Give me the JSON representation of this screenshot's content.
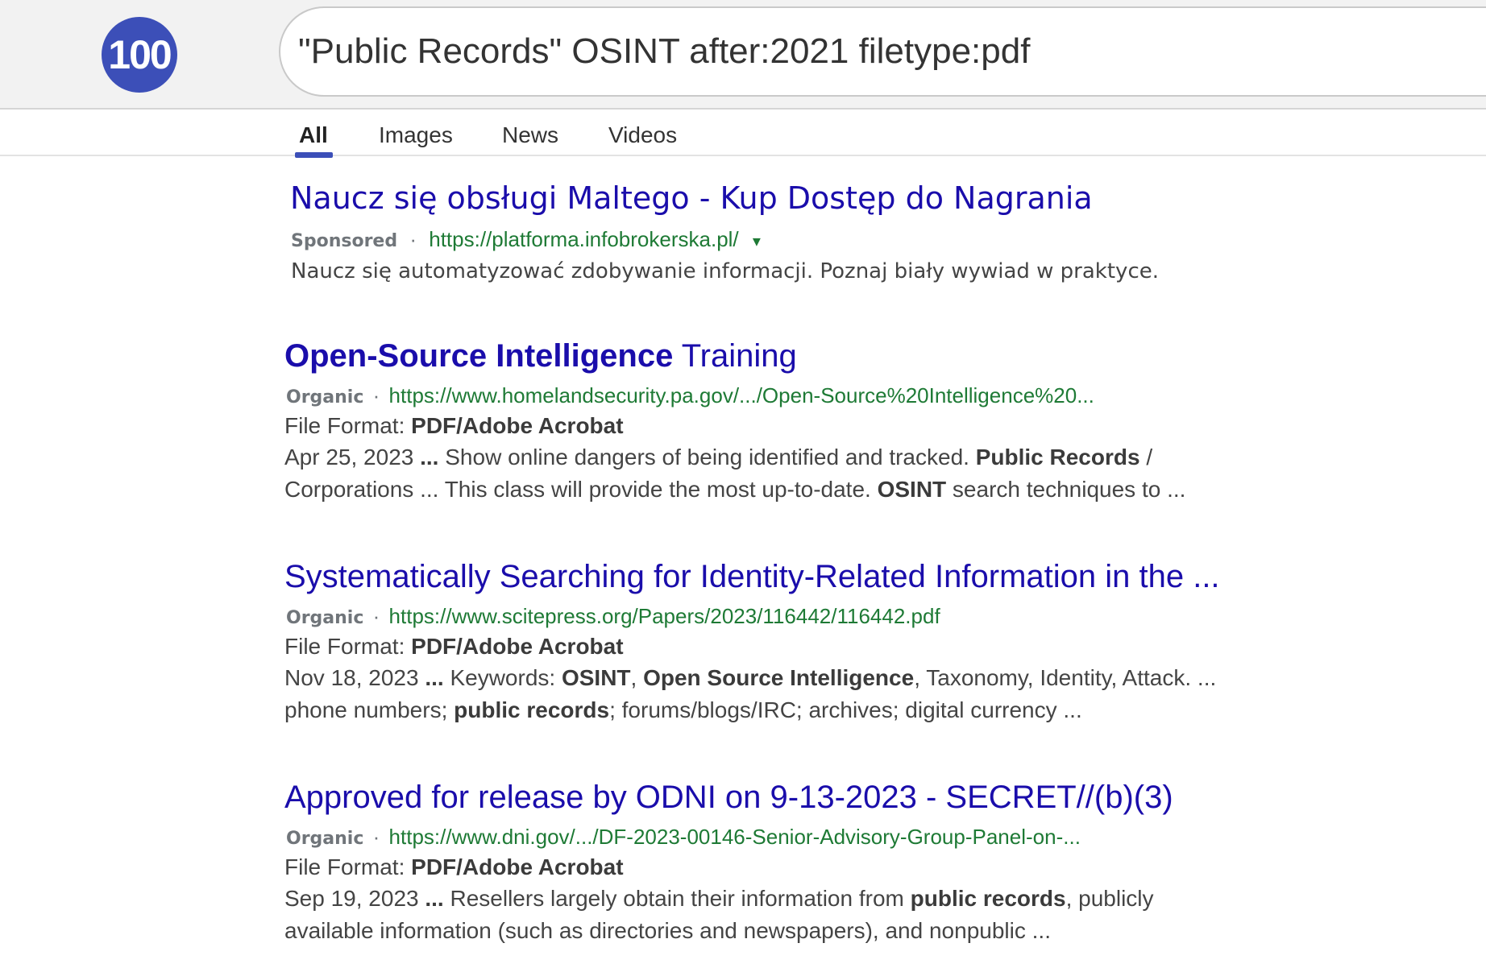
{
  "logo": {
    "text": "100",
    "color": "#3c4fb8"
  },
  "search": {
    "query": "\"Public Records\" OSINT after:2021 filetype:pdf"
  },
  "tabs": [
    {
      "label": "All",
      "active": true
    },
    {
      "label": "Images"
    },
    {
      "label": "News"
    },
    {
      "label": "Videos"
    }
  ],
  "sponsored": {
    "title": "Naucz się obsługi Maltego - Kup Dostęp do Nagrania",
    "tag": "Sponsored",
    "separator": "·",
    "url": "https://platforma.infobrokerska.pl/",
    "caret": "▾",
    "description": "Naucz się automatyzować zdobywanie informacji. Poznaj biały wywiad w praktyce."
  },
  "results": [
    {
      "title_bold": "Open-Source Intelligence",
      "title_rest": " Training",
      "tag": "Organic",
      "separator": "·",
      "url": "https://www.homelandsecurity.pa.gov/.../Open-Source%20Intelligence%20...",
      "format_label": "File Format:",
      "format_value": "PDF/Adobe Acrobat",
      "snippet1": {
        "a": "Apr 25, 2023 ",
        "b": "...",
        "c": " Show online dangers of being identified and tracked. ",
        "d": "Public Records",
        "e": " /"
      },
      "snippet2": {
        "a": "Corporations ... This class will provide the most up-to-date. ",
        "b": "OSINT",
        "c": " search techniques to ..."
      }
    },
    {
      "title": "Systematically Searching for Identity-Related Information in the ...",
      "tag": "Organic",
      "separator": "·",
      "url": "https://www.scitepress.org/Papers/2023/116442/116442.pdf",
      "format_label": "File Format:",
      "format_value": "PDF/Adobe Acrobat",
      "snippet1": {
        "a": "Nov 18, 2023 ",
        "b": "...",
        "c": " Keywords: ",
        "d": "OSINT",
        "e": ", ",
        "f": "Open Source Intelligence",
        "g": ", Taxonomy, Identity, Attack. ..."
      },
      "snippet2": {
        "a": "phone numbers; ",
        "b": "public records",
        "c": "; forums/blogs/IRC; archives; digital currency ..."
      }
    },
    {
      "title": "Approved for release by ODNI on 9-13-2023 - SECRET//(b)(3)",
      "tag": "Organic",
      "separator": "·",
      "url": "https://www.dni.gov/.../DF-2023-00146-Senior-Advisory-Group-Panel-on-...",
      "format_label": "File Format:",
      "format_value": "PDF/Adobe Acrobat",
      "snippet1": {
        "a": "Sep 19, 2023 ",
        "b": "...",
        "c": " Resellers largely obtain their information from ",
        "d": "public records",
        "e": ", publicly"
      },
      "snippet2": {
        "a": "available information (such as directories and newspapers), and nonpublic ..."
      }
    }
  ]
}
